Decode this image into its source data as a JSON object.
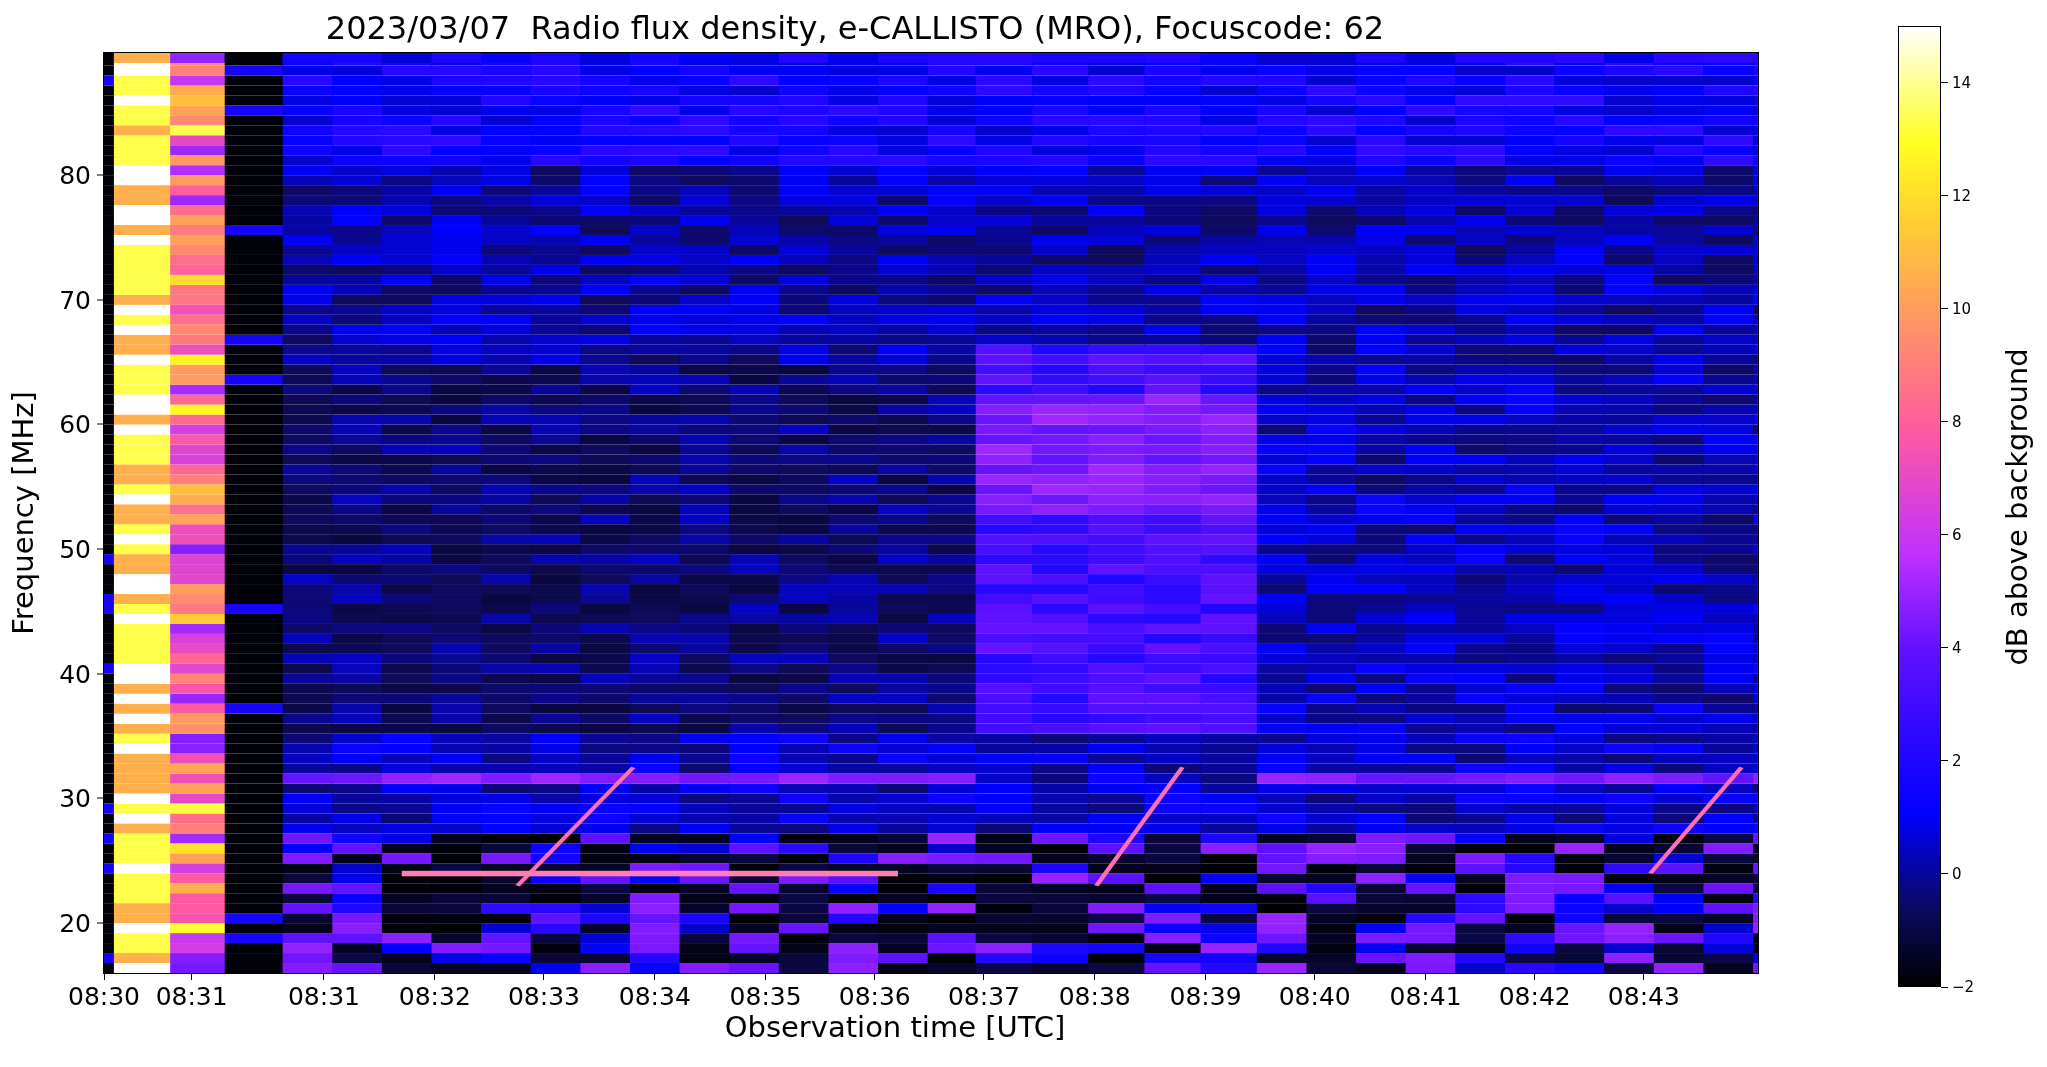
{
  "title": "2023/03/07  Radio flux density, e-CALLISTO (MRO), Focuscode: 62",
  "ylabel": "Frequency [MHz]",
  "xlabel": "Observation time [UTC]",
  "yticks": [
    "80",
    "70",
    "60",
    "50",
    "40",
    "30",
    "20"
  ],
  "xticks": [
    "08:30",
    "08:31",
    "08:31",
    "08:32",
    "08:33",
    "08:34",
    "08:35",
    "08:36",
    "08:37",
    "08:38",
    "08:39",
    "08:40",
    "08:41",
    "08:42",
    "08:43"
  ],
  "colorbar": {
    "label": "dB above background",
    "ticks": [
      "14",
      "12",
      "10",
      "8",
      "6",
      "4",
      "2",
      "0",
      "−2"
    ]
  }
}
